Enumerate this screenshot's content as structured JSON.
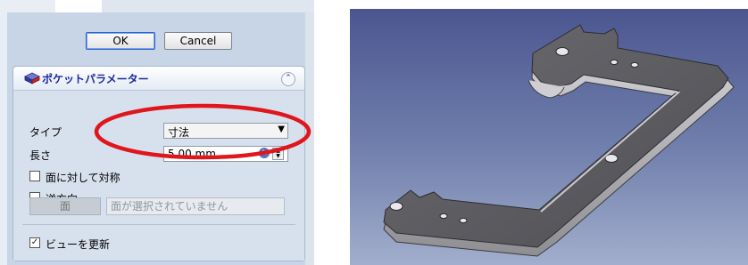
{
  "dialog": {
    "ok_label": "OK",
    "cancel_label": "Cancel"
  },
  "pocket_panel": {
    "title": "ポケットパラメーター",
    "type_label": "タイプ",
    "type_value": "寸法",
    "length_label": "長さ",
    "length_value": "5.00 mm",
    "symmetric_label": "面に対して対称",
    "symmetric_checked": false,
    "reversed_label": "逆方向",
    "reversed_checked": false,
    "face_button_label": "面",
    "face_field_text": "面が選択されていません",
    "update_view_label": "ビューを更新",
    "update_view_checked": true
  },
  "icons": {
    "header": "pocket-feature-icon",
    "collapse": "chevron-up-double-icon",
    "expression": "fx-icon",
    "combo_arrow": "dropdown-arrow-icon"
  },
  "colors": {
    "panel_bg": "#c7d5e6",
    "title_blue": "#1b2a9c",
    "highlight_red": "#e0161c",
    "viewport_top": "#4b5690",
    "viewport_bottom": "#a2aecd",
    "part_gray": "#5a5a5f"
  }
}
